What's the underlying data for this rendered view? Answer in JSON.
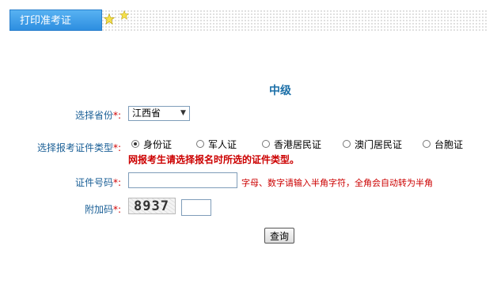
{
  "tab": {
    "label": "打印准考证"
  },
  "level": "中级",
  "form": {
    "province": {
      "label": "选择省份",
      "required_mark": "*:",
      "selected": "江西省"
    },
    "id_type": {
      "label": "选择报考证件类型",
      "required_mark": "*:",
      "options": [
        "身份证",
        "军人证",
        "香港居民证",
        "澳门居民证",
        "台胞证"
      ],
      "selected_index": 0,
      "notice": "网报考生请选择报名时所选的证件类型。"
    },
    "id_number": {
      "label": "证件号码",
      "required_mark": "*:",
      "value": "",
      "hint": "字母、数字请输入半角字符，全角会自动转为半角"
    },
    "captcha": {
      "label": "附加码",
      "required_mark": "*:",
      "image_text": "8937",
      "value": ""
    },
    "submit_label": "查询"
  }
}
